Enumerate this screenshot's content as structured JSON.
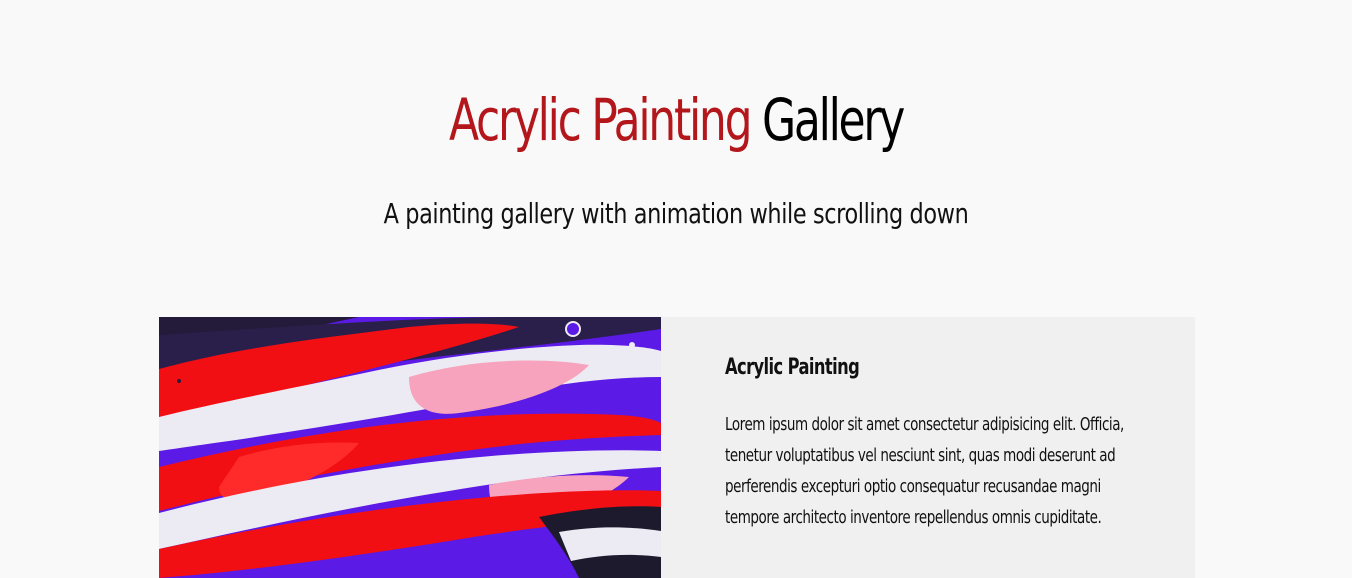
{
  "header": {
    "title_accent": "Acrylic Painting",
    "title_rest": "Gallery",
    "subtitle": "A painting gallery with animation while scrolling down"
  },
  "card": {
    "title": "Acrylic Painting",
    "text": "Lorem ipsum dolor sit amet consectetur adipisicing elit. Officia, tenetur voluptatibus vel nesciunt sint, quas modi deserunt ad perferendis excepturi optio consequatur recusandae magni tempore architecto inventore repellendus omnis cupiditate."
  },
  "colors": {
    "accent": "#b3171c",
    "background": "#f9f9f9",
    "card_background": "#f0f0f0",
    "paint_purple": "#5b1ae6",
    "paint_red": "#f20f14",
    "paint_pink": "#f7a3bd",
    "paint_white": "#eceaf2"
  }
}
